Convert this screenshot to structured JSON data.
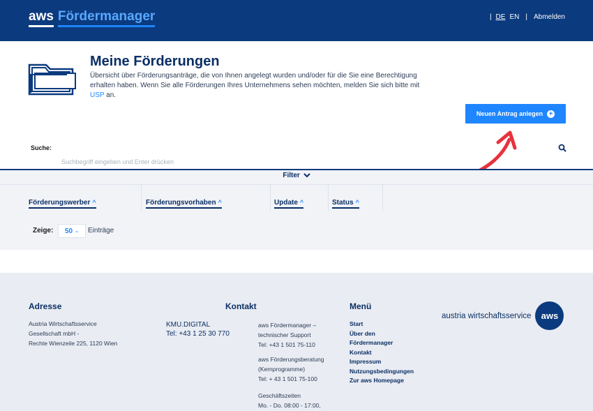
{
  "header": {
    "brand_aws": "aws",
    "brand_name": "Fördermanager",
    "sep_left": "|",
    "lang_de": "DE",
    "lang_en": "EN",
    "sep_right": "|",
    "logout": "Abmelden"
  },
  "intro": {
    "title": "Meine Förderungen",
    "description": "Übersicht über Förderungsanträge, die von Ihnen angelegt wurden und/oder für die Sie eine Berechtigung erhalten haben. Wenn Sie alle Förderungen Ihres Unternehmens sehen möchten, melden Sie sich bitte mit",
    "usp_link": "USP",
    "description_end": "an.",
    "icon": "folder-icon"
  },
  "actions": {
    "new_application": "Neuen Antrag anlegen",
    "new_icon": "plus-circle-icon",
    "accent_color": "#1e86ff"
  },
  "search": {
    "label": "Suche:",
    "placeholder": "Suchbegriff eingeben und Enter drücken",
    "icon": "search-icon"
  },
  "filter": {
    "label": "Filter",
    "icon": "chevron-down-icon"
  },
  "table": {
    "columns": [
      {
        "label": "Förderungswerber",
        "sort": "^"
      },
      {
        "label": "Förderungsvorhaben",
        "sort": "^"
      },
      {
        "label": "Update",
        "sort": "^"
      },
      {
        "label": "Status",
        "sort": "^"
      }
    ],
    "show_label": "Zeige:",
    "page_size": "50",
    "entries_label": "Einträge"
  },
  "footer": {
    "address": {
      "heading": "Adresse",
      "line1": "Austria Wirtschaftsservice",
      "line2": "Gesellschaft mbH -",
      "line3": "Rechte Wienzeile 225, 1120 Wien"
    },
    "contact": {
      "heading": "Kontakt",
      "kmu_name": "KMU.DIGITAL",
      "kmu_tel": "Tel: +43 1 25 30 770",
      "support_title1": "aws Fördermanager –",
      "support_title2": "technischer Support",
      "support_tel": "Tel: +43 1 501 75-110",
      "advice_title1": "aws Förderungsberatung",
      "advice_title2": "(Kernprogramme)",
      "advice_tel": "Tel: + 43 1 501 75-100",
      "hours_title": "Geschäftszeiten",
      "hours_text": "Mo. - Do. 08:00 - 17:00,"
    },
    "menu": {
      "heading": "Menü",
      "items": [
        "Start",
        "Über den",
        "Fördermanager",
        "Kontakt",
        "Impressum",
        "Nutzungsbedingungen",
        "Zur aws Homepage"
      ]
    },
    "logo": {
      "text": "austria wirtschaftsservice",
      "badge": "aws"
    }
  },
  "colors": {
    "header_bg": "#0b3a7e",
    "title": "#0b2f66",
    "annotation_arrow": "#e8323c"
  }
}
